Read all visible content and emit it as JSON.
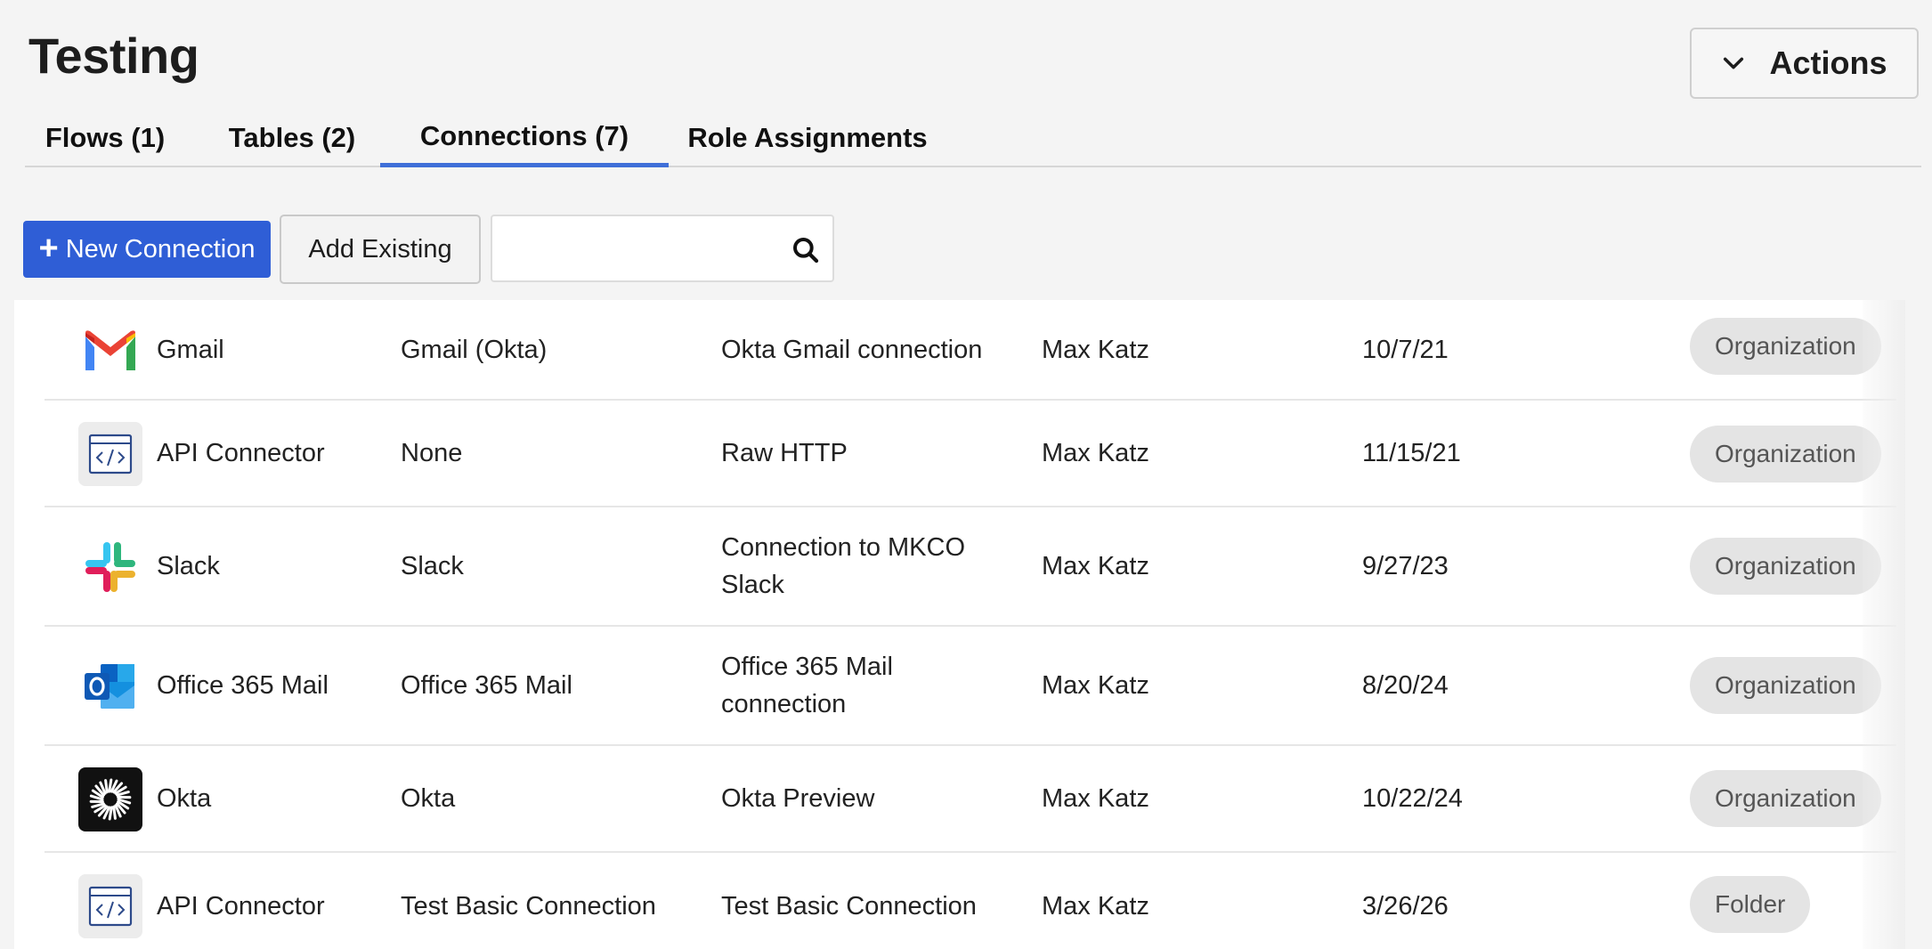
{
  "header": {
    "title": "Testing",
    "actions_label": "Actions"
  },
  "tabs": [
    {
      "label": "Flows (1)",
      "active": false
    },
    {
      "label": "Tables (2)",
      "active": false
    },
    {
      "label": "Connections (7)",
      "active": true
    },
    {
      "label": "Role Assignments",
      "active": false
    }
  ],
  "toolbar": {
    "new_connection_label": "New Connection",
    "add_existing_label": "Add Existing",
    "search_placeholder": "",
    "search_value": ""
  },
  "colors": {
    "accent": "#2f5ed6",
    "tab_underline": "#3f6fd8",
    "badge_bg": "#e4e4e4"
  },
  "connections": [
    {
      "icon": "gmail-icon",
      "app": "Gmail",
      "auth": "Gmail (Okta)",
      "description": "Okta Gmail connection",
      "owner": "Max Katz",
      "date": "10/7/21",
      "scope": "Organization"
    },
    {
      "icon": "api-connector-icon",
      "app": "API Connector",
      "auth": "None",
      "description": "Raw HTTP",
      "owner": "Max Katz",
      "date": "11/15/21",
      "scope": "Organization"
    },
    {
      "icon": "slack-icon",
      "app": "Slack",
      "auth": "Slack",
      "description": "Connection to MKCO Slack",
      "owner": "Max Katz",
      "date": "9/27/23",
      "scope": "Organization"
    },
    {
      "icon": "outlook-icon",
      "app": "Office 365 Mail",
      "auth": "Office 365 Mail",
      "description": "Office 365 Mail connection",
      "owner": "Max Katz",
      "date": "8/20/24",
      "scope": "Organization"
    },
    {
      "icon": "okta-icon",
      "app": "Okta",
      "auth": "Okta",
      "description": "Okta Preview",
      "owner": "Max Katz",
      "date": "10/22/24",
      "scope": "Organization"
    },
    {
      "icon": "api-connector-icon",
      "app": "API Connector",
      "auth": "Test Basic Connection",
      "description": "Test Basic Connection",
      "owner": "Max Katz",
      "date": "3/26/26",
      "scope": "Folder"
    }
  ]
}
